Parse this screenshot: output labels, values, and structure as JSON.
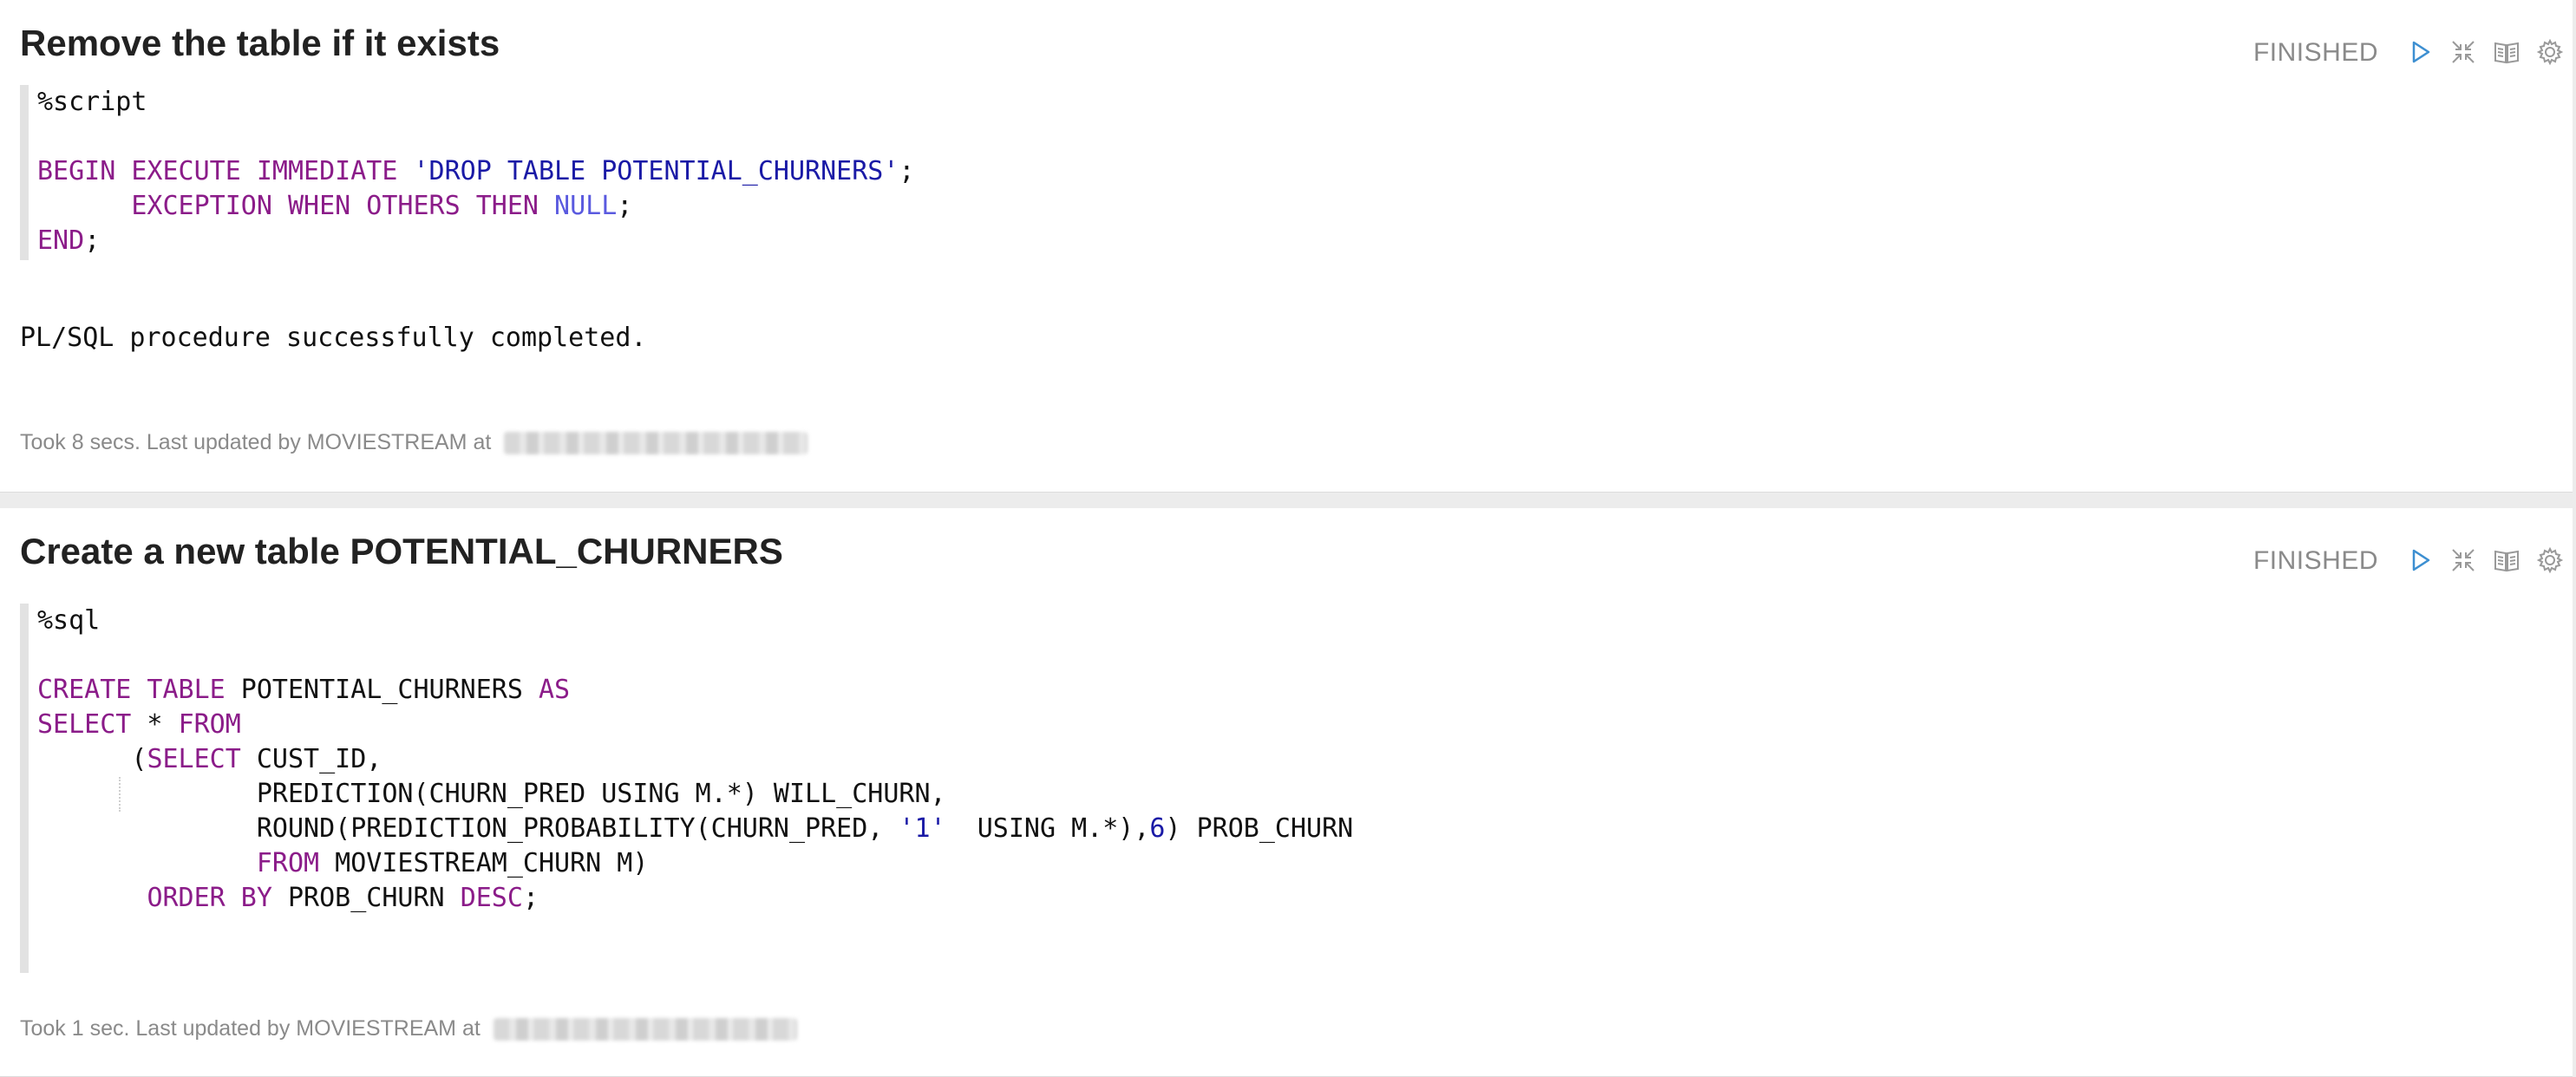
{
  "paragraphs": [
    {
      "title": "Remove the table if it exists",
      "status": "FINISHED",
      "code": {
        "l1": "%script",
        "l3_kw1": "BEGIN EXECUTE IMMEDIATE ",
        "l3_str": "'DROP TABLE POTENTIAL_CHURNERS'",
        "l3_end": ";",
        "l4_kw": "EXCEPTION WHEN OTHERS THEN ",
        "l4_null": "NULL",
        "l4_end": ";",
        "l5_kw": "END",
        "l5_end": ";"
      },
      "output": "PL/SQL procedure successfully completed.",
      "footer": "Took 8 secs. Last updated by MOVIESTREAM at "
    },
    {
      "title": "Create a new table POTENTIAL_CHURNERS",
      "status": "FINISHED",
      "code": {
        "l1": "%sql",
        "l3_kw1": "CREATE TABLE",
        "l3_txt": " POTENTIAL_CHURNERS ",
        "l3_kw2": "AS",
        "l4_kw": "SELECT",
        "l4_txt": " * ",
        "l4_kw2": "FROM",
        "l5_paren": "(",
        "l5_kw": "SELECT",
        "l5_txt": " CUST_ID,",
        "l6_txt": "PREDICTION(CHURN_PRED USING M.*) WILL_CHURN,",
        "l7_a": "ROUND(PREDICTION_PROBABILITY(CHURN_PRED, ",
        "l7_str": "'1'",
        "l7_b": "  USING M.*),",
        "l7_num": "6",
        "l7_c": ") PROB_CHURN",
        "l8_kw": "FROM",
        "l8_txt": " MOVIESTREAM_CHURN M)",
        "l9_kw": "ORDER BY",
        "l9_txt": " PROB_CHURN ",
        "l9_kw2": "DESC",
        "l9_end": ";"
      },
      "footer": "Took 1 sec. Last updated by MOVIESTREAM at "
    }
  ]
}
